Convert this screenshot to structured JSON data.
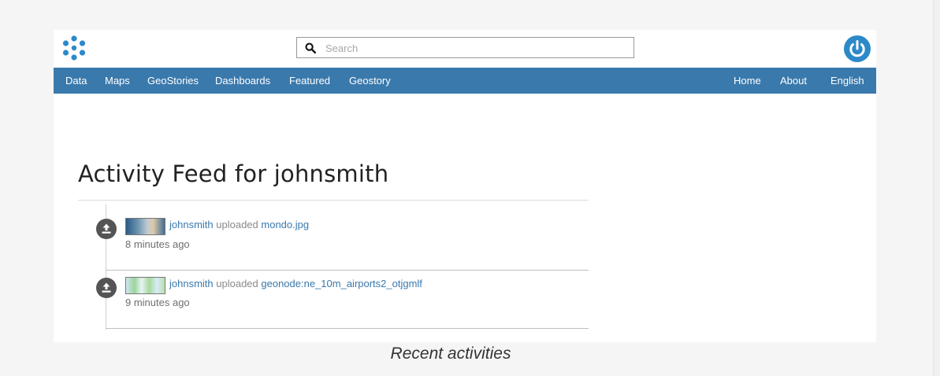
{
  "header": {
    "logo_icon": "geonode-logo-icon",
    "search": {
      "placeholder": "Search"
    },
    "power_icon": "power-icon"
  },
  "nav": {
    "left": [
      "Data",
      "Maps",
      "GeoStories",
      "Dashboards",
      "Featured",
      "Geostory"
    ],
    "right": [
      "Home",
      "About",
      "English"
    ]
  },
  "feed": {
    "title": "Activity Feed for johnsmith",
    "items": [
      {
        "user": "johnsmith",
        "verb": "uploaded",
        "object": "mondo.jpg",
        "time": "8 minutes ago"
      },
      {
        "user": "johnsmith",
        "verb": "uploaded",
        "object": "geonode:ne_10m_airports2_otjgmlf",
        "time": "9 minutes ago"
      }
    ]
  },
  "caption": "Recent activities",
  "colors": {
    "navbar": "#3a79ac",
    "link": "#3a79ac",
    "power": "#2c89c9",
    "activity_icon": "#545454"
  }
}
